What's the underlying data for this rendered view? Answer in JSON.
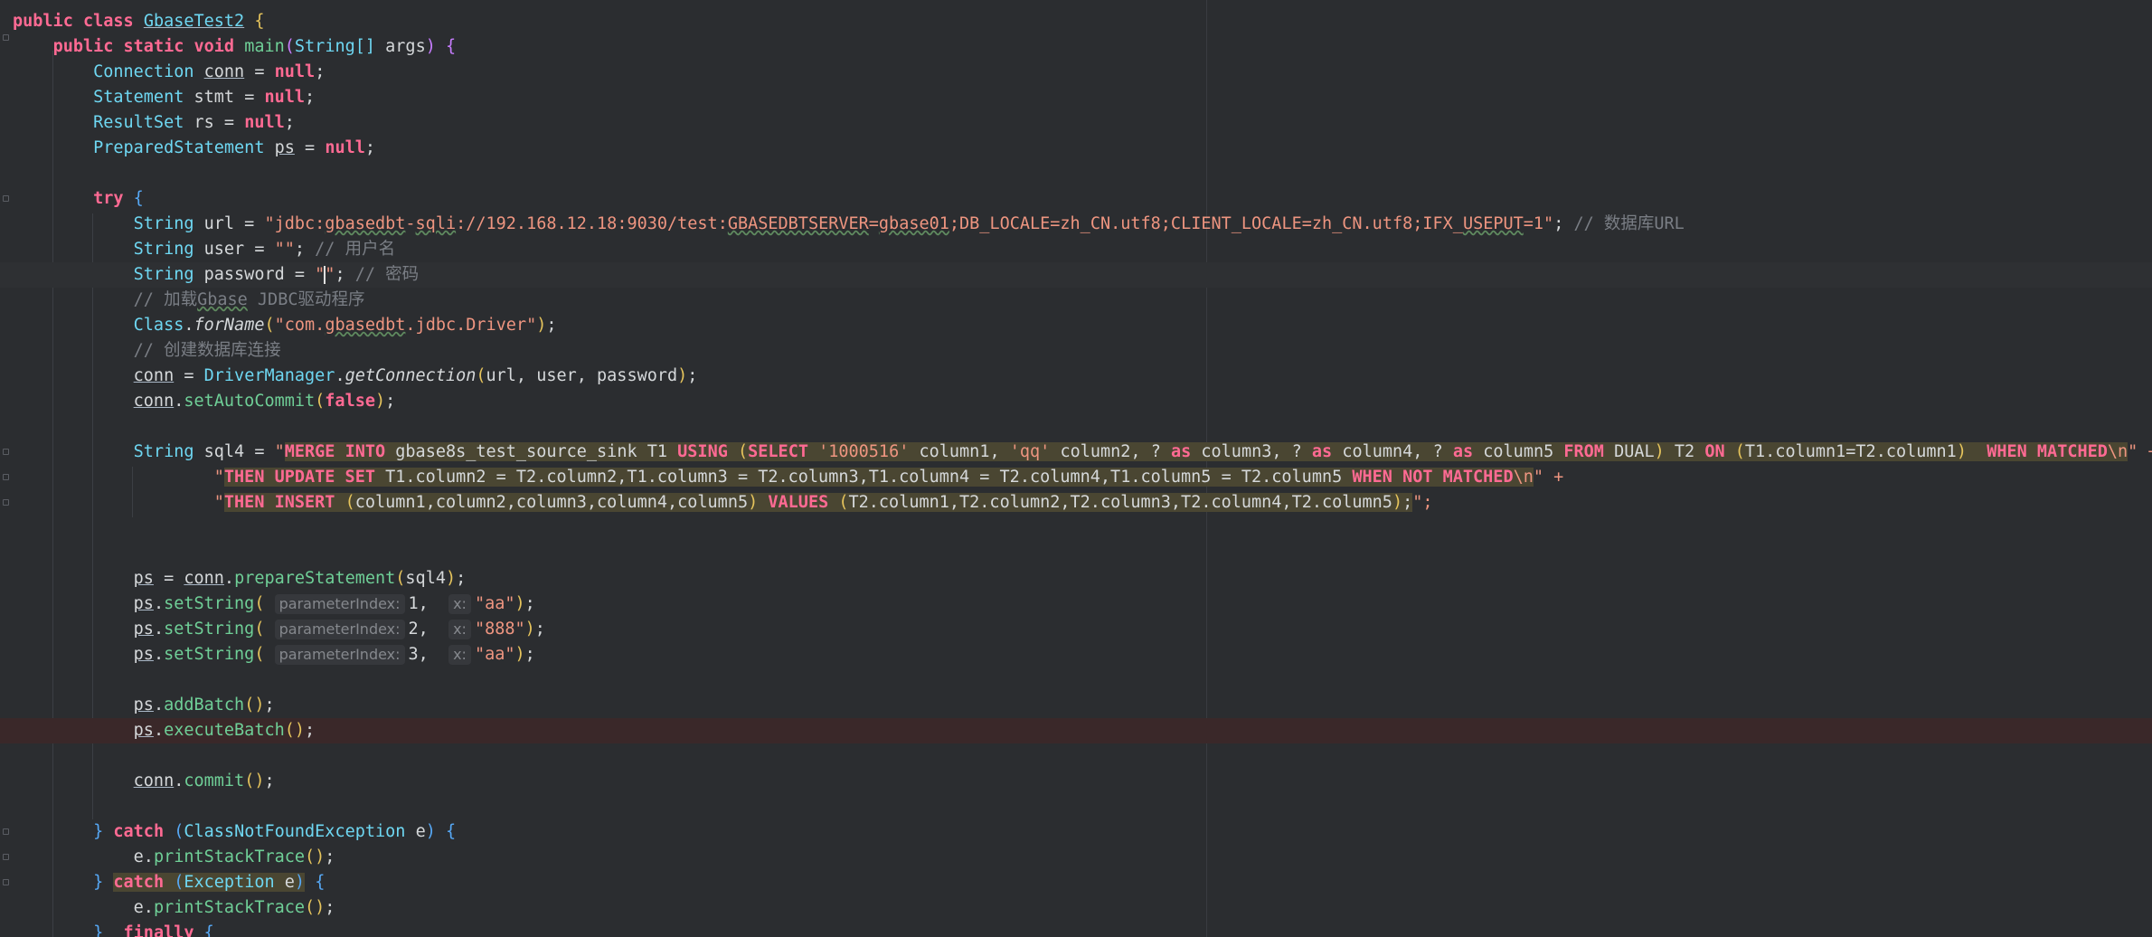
{
  "editor": {
    "lines": {
      "l1": {
        "kw1": "public",
        "kw2": "class",
        "name": "GbaseTest2",
        "brace": "{"
      },
      "l2": {
        "kw1": "public",
        "kw2": "static",
        "kw3": "void",
        "fn": "main",
        "params_type": "String[]",
        "params_name": "args"
      },
      "l3": {
        "type": "Connection",
        "var": "conn",
        "val": "null"
      },
      "l4": {
        "type": "Statement",
        "var": "stmt",
        "val": "null"
      },
      "l5": {
        "type": "ResultSet",
        "var": "rs",
        "val": "null"
      },
      "l6": {
        "type": "PreparedStatement",
        "var": "ps",
        "val": "null"
      },
      "l8": {
        "kw": "try"
      },
      "l9": {
        "type": "String",
        "var": "url",
        "p1": "\"jdbc:",
        "p2": "gbasedbt",
        "p3": "-",
        "p4": "sqli",
        "p5": "://192.168.12.18:9030/test:",
        "p6": "GBASEDBTSERVER",
        "p7": "=",
        "p8": "gbase01",
        "p9": ";DB_LOCALE=zh_CN.utf8;CLIENT_LOCALE=zh_CN.utf8;IFX_",
        "p10": "USEPUT",
        "p11": "=1\"",
        "comment": "// 数据库URL"
      },
      "l10": {
        "type": "String",
        "var": "user",
        "val": "\"\"",
        "comment": "// 用户名"
      },
      "l11": {
        "type": "String",
        "var": "password",
        "val_open": "\"",
        "val_close": "\"",
        "comment": "// 密码"
      },
      "l12": {
        "c1": "// 加载",
        "c2": "Gbase",
        "c3": " JDBC驱动程序"
      },
      "l13": {
        "cls": "Class",
        "fn": "forName",
        "s1": "\"com.",
        "s2": "gbasedbt",
        "s3": ".jdbc.Driver\""
      },
      "l14": {
        "comment": "// 创建数据库连接"
      },
      "l15": {
        "var": "conn",
        "cls": "DriverManager",
        "fn": "getConnection",
        "args": "url, user, password"
      },
      "l16": {
        "var": "conn",
        "fn": "setAutoCommit",
        "arg": "false"
      },
      "l18": {
        "type": "String",
        "var": "sql4",
        "q": "\"",
        "a": "MERGE INTO",
        "b": " gbase8s_test_source_sink T1 ",
        "c": "USING",
        "d": "(",
        "e": "SELECT",
        "f": "'1000516'",
        "g": " column1, ",
        "h": "'qq'",
        "i": " column2, ? ",
        "j": "as",
        "k": " column3, ? ",
        "l": "as",
        "m": " column4, ? ",
        "n": "as",
        "o": " column5 ",
        "p": "FROM",
        "r": " DUAL",
        "s": ")",
        "t": " T2 ",
        "u": "ON",
        "v": "(",
        "w": "T1.column1=T2.column1",
        "x": ")",
        "y": "  WHEN MATCHED",
        "z": "\\n",
        "end": "\" +"
      },
      "l19": {
        "q": "\"",
        "a": "THEN UPDATE SET",
        "b": " T1.column2 = T2.column2,T1.column3 = T2.column3,T1.column4 = T2.column4,T1.column5 = T2.column5 ",
        "c": "WHEN NOT MATCHED",
        "z": "\\n",
        "end": "\" +"
      },
      "l20": {
        "q": "\"",
        "a": "THEN INSERT",
        "b": "(",
        "c": "column1,column2,column3,column4,column5",
        "d": ")",
        "e": "VALUES",
        "f": "(",
        "g": "T2.column1,T2.column2,T2.column3,T2.column4,T2.column5",
        "h": ")",
        "i": ";",
        "end": "\";"
      },
      "l23": {
        "var": "ps",
        "var2": "conn",
        "fn": "prepareStatement",
        "arg": "sql4"
      },
      "l24": {
        "var": "ps",
        "fn": "setString",
        "hint1": "parameterIndex:",
        "n": "1",
        "hint2": "x:",
        "s": "\"aa\""
      },
      "l25": {
        "var": "ps",
        "fn": "setString",
        "hint1": "parameterIndex:",
        "n": "2",
        "hint2": "x:",
        "s": "\"888\""
      },
      "l26": {
        "var": "ps",
        "fn": "setString",
        "hint1": "parameterIndex:",
        "n": "3",
        "hint2": "x:",
        "s": "\"aa\""
      },
      "l28": {
        "var": "ps",
        "fn": "addBatch"
      },
      "l29": {
        "var": "ps",
        "fn": "executeBatch"
      },
      "l31": {
        "var": "conn",
        "fn": "commit"
      },
      "l33": {
        "kw": "catch",
        "type": "ClassNotFoundException",
        "var": "e"
      },
      "l34": {
        "var": "e",
        "fn": "printStackTrace"
      },
      "l35": {
        "kw": "catch",
        "type": "Exception",
        "var": "e"
      },
      "l36": {
        "var": "e",
        "fn": "printStackTrace"
      },
      "l37": {
        "kw": "finally"
      }
    }
  },
  "colors": {
    "background": "#2b2d30",
    "keyword": "#ff6a93",
    "type": "#6ed7f2",
    "function": "#6fcf97",
    "string": "#ee9580",
    "comment": "#7a7e85",
    "error_row": "#3a2829"
  }
}
